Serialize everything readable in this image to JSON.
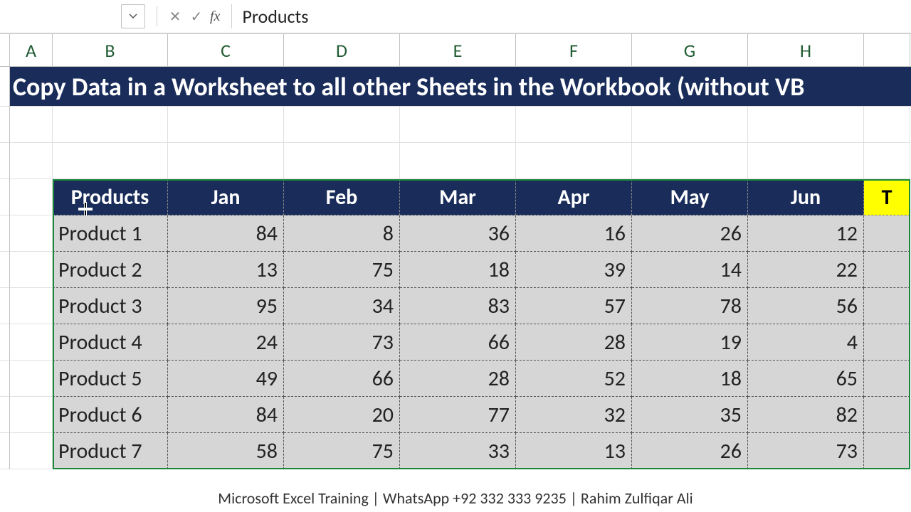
{
  "formula_bar": {
    "cancel_glyph": "✕",
    "accept_glyph": "✓",
    "fx_label": "fx",
    "value": "Products"
  },
  "columns": [
    "A",
    "B",
    "C",
    "D",
    "E",
    "F",
    "G",
    "H"
  ],
  "title_row": "Copy Data in a Worksheet to all other Sheets in the Workbook (without VB",
  "table": {
    "header": [
      "Products",
      "Jan",
      "Feb",
      "Mar",
      "Apr",
      "May",
      "Jun"
    ],
    "tail_header": "T",
    "rows": [
      {
        "name": "Product 1",
        "vals": [
          84,
          8,
          36,
          16,
          26,
          12
        ]
      },
      {
        "name": "Product 2",
        "vals": [
          13,
          75,
          18,
          39,
          14,
          22
        ]
      },
      {
        "name": "Product 3",
        "vals": [
          95,
          34,
          83,
          57,
          78,
          56
        ]
      },
      {
        "name": "Product 4",
        "vals": [
          24,
          73,
          66,
          28,
          19,
          4
        ]
      },
      {
        "name": "Product 5",
        "vals": [
          49,
          66,
          28,
          52,
          18,
          65
        ]
      },
      {
        "name": "Product 6",
        "vals": [
          84,
          20,
          77,
          32,
          35,
          82
        ]
      },
      {
        "name": "Product 7",
        "vals": [
          58,
          75,
          33,
          13,
          26,
          73
        ]
      }
    ]
  },
  "footer": "Microsoft Excel Training | WhatsApp +92 332 333 9235 | Rahim Zulfiqar Ali"
}
